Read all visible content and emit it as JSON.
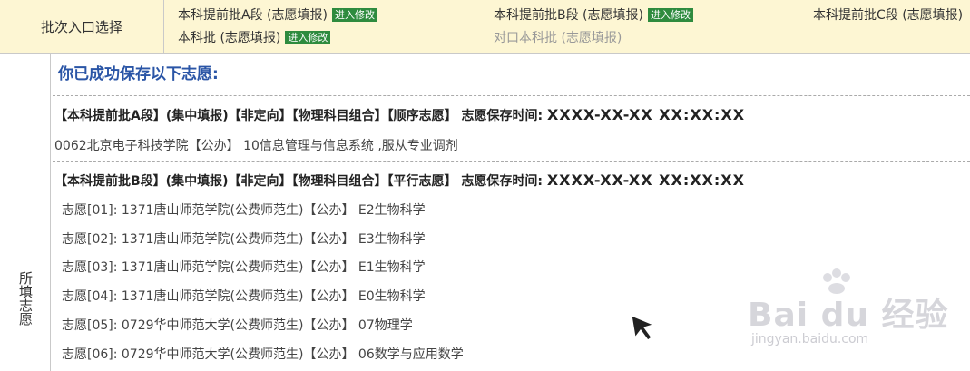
{
  "batch": {
    "label": "批次入口选择",
    "options": [
      {
        "name": "本科提前批A段 (志愿填报)",
        "button": "进入修改",
        "enabled": true
      },
      {
        "name": "本科提前批B段 (志愿填报)",
        "button": "进入修改",
        "enabled": true
      },
      {
        "name": "本科提前批C段 (志愿填报)",
        "button": "",
        "enabled": true
      },
      {
        "name": "本科批 (志愿填报)",
        "button": "进入修改",
        "enabled": true
      },
      {
        "name": "对口本科批 (志愿填报)",
        "button": "",
        "enabled": false
      }
    ]
  },
  "side_label": "所填志愿",
  "saved_title": "你已成功保存以下志愿:",
  "sections": [
    {
      "header": "【本科提前批A段】(集中填报)【非定向】【物理科目组合】【顺序志愿】 志愿保存时间:",
      "time": "XXXX-XX-XX  XX:XX:XX",
      "lines": [
        "0062北京电子科技学院【公办】 10信息管理与信息系统 ,服从专业调剂"
      ]
    },
    {
      "header": "【本科提前批B段】(集中填报)【非定向】【物理科目组合】【平行志愿】 志愿保存时间:",
      "time": "XXXX-XX-XX  XX:XX:XX",
      "rows": [
        "志愿[01]:  1371唐山师范学院(公费师范生)【公办】 E2生物科学",
        "志愿[02]:  1371唐山师范学院(公费师范生)【公办】 E3生物科学",
        "志愿[03]:  1371唐山师范学院(公费师范生)【公办】 E1生物科学",
        "志愿[04]:  1371唐山师范学院(公费师范生)【公办】 E0生物科学",
        "志愿[05]:  0729华中师范大学(公费师范生)【公办】 07物理学",
        "志愿[06]:  0729华中师范大学(公费师范生)【公办】 06数学与应用数学"
      ]
    }
  ],
  "watermark": {
    "brand": "Bai du 经验",
    "url": "jingyan.baidu.com"
  },
  "colors": {
    "accent_green": "#2e8b3e",
    "title_blue": "#2a55a6",
    "bar_bg": "#fdf6d3"
  }
}
